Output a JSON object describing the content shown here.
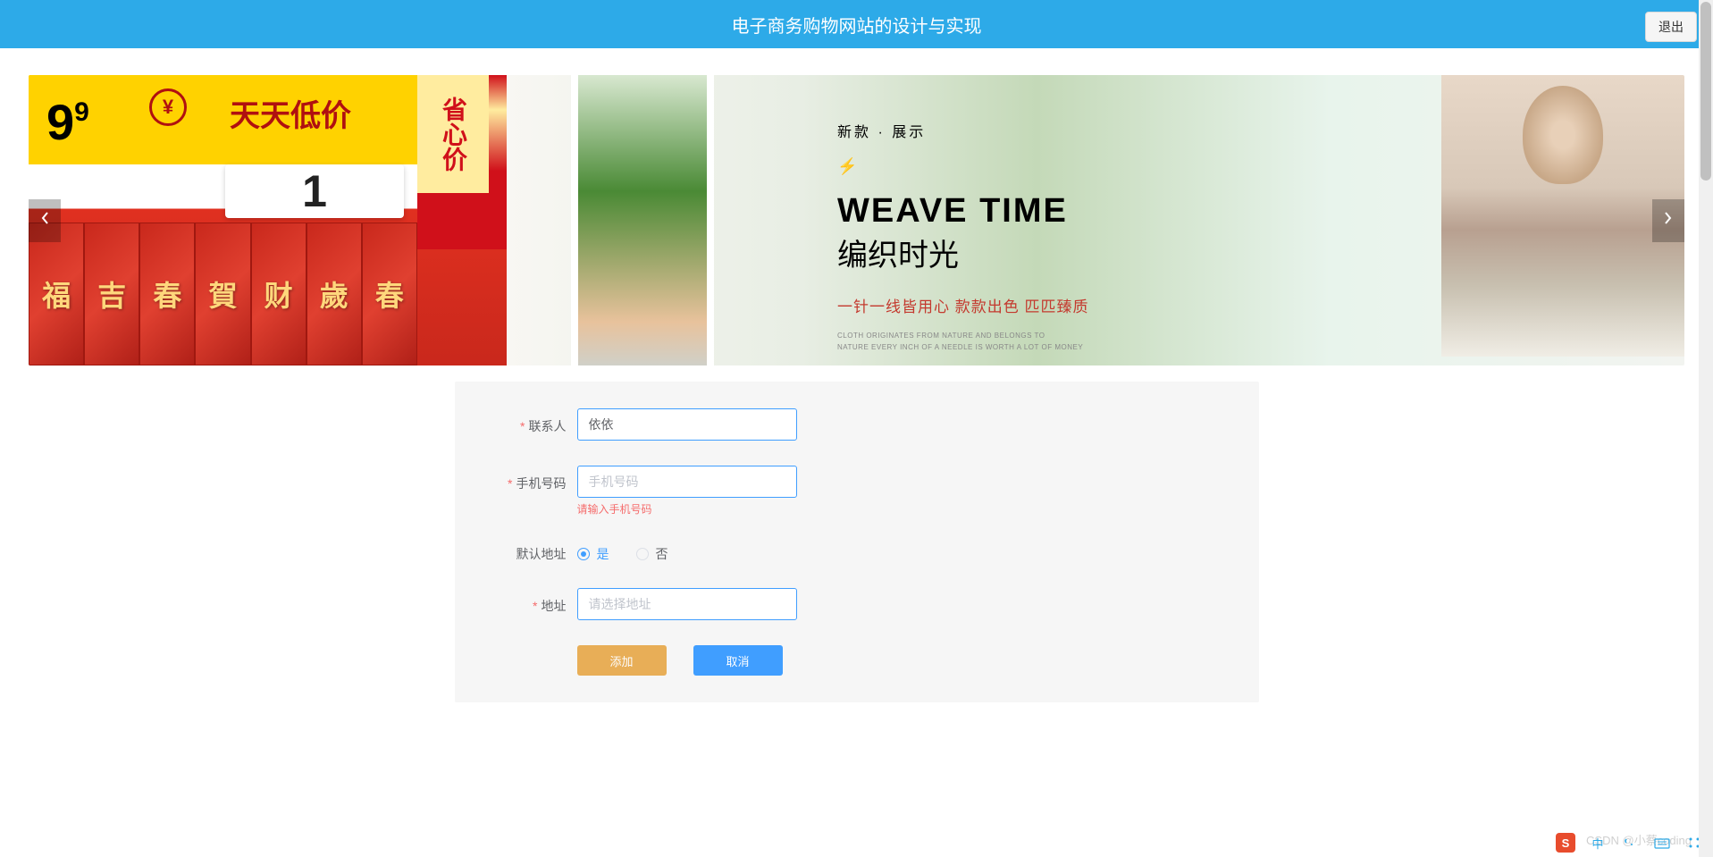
{
  "header": {
    "title": "电子商务购物网站的设计与实现",
    "logout": "退出"
  },
  "carousel": {
    "slide1_price_big": "9",
    "slide1_price_sup": "9",
    "slide1_yen": "¥",
    "slide1_lowprice": "天天低价",
    "slide1_big_one": "1",
    "slide1_side_text": "省心价",
    "fu_chars": [
      "福",
      "吉",
      "春",
      "賀",
      "财",
      "歲",
      "春"
    ]
  },
  "slide2": {
    "sub": "新款 · 展示",
    "lightning": "⚡",
    "title_en": "WEAVE TIME",
    "title_cn": "编织时光",
    "tagline": "一针一线皆用心 款款出色 匹匹臻质",
    "small1": "CLOTH ORIGINATES FROM NATURE AND BELONGS TO",
    "small2": "NATURE EVERY INCH OF A NEEDLE IS WORTH A LOT OF MONEY"
  },
  "form": {
    "contact_label": "联系人",
    "contact_value": "依依",
    "phone_label": "手机号码",
    "phone_placeholder": "手机号码",
    "phone_value": "",
    "phone_error": "请输入手机号码",
    "default_addr_label": "默认地址",
    "radio_yes": "是",
    "radio_no": "否",
    "default_addr_value": "yes",
    "address_label": "地址",
    "address_placeholder": "请选择地址",
    "address_value": "",
    "add_button": "添加",
    "cancel_button": "取消"
  },
  "watermark": "CSDN @小蔡coding",
  "ime": {
    "s_label": "S",
    "cn_label": "中"
  }
}
